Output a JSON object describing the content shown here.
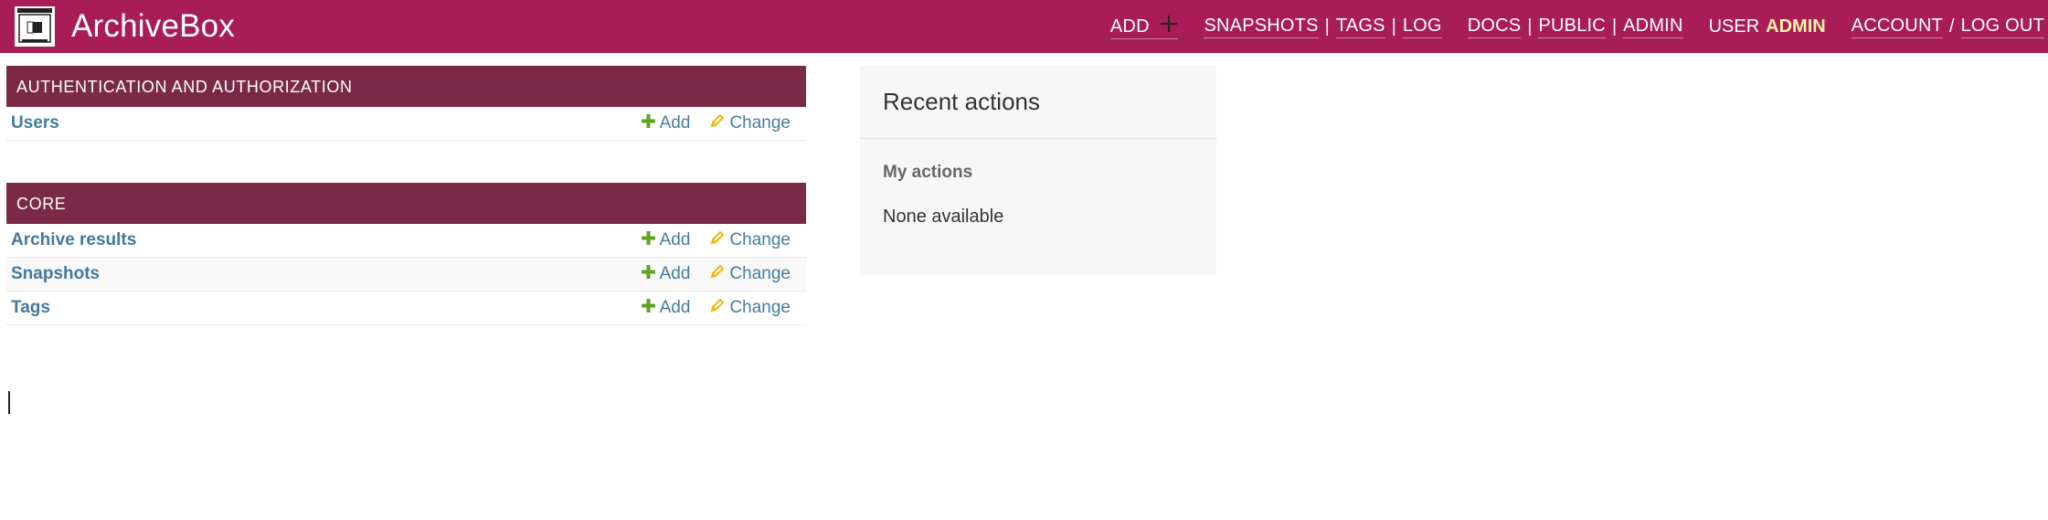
{
  "header": {
    "brand": "ArchiveBox",
    "add_label": "ADD",
    "snapshots_label": "SNAPSHOTS",
    "tags_label": "TAGS",
    "log_label": "LOG",
    "docs_label": "DOCS",
    "public_label": "PUBLIC",
    "admin_label": "ADMIN",
    "user_prefix": "USER",
    "username": "ADMIN",
    "account_label": "ACCOUNT",
    "logout_label": "LOG OUT",
    "sep_bar": "|",
    "sep_slash": "/"
  },
  "modules": [
    {
      "caption": "AUTHENTICATION AND AUTHORIZATION",
      "rows": [
        {
          "name": "Users",
          "add": "Add",
          "change": "Change"
        }
      ]
    },
    {
      "caption": "CORE",
      "rows": [
        {
          "name": "Archive results",
          "add": "Add",
          "change": "Change"
        },
        {
          "name": "Snapshots",
          "add": "Add",
          "change": "Change"
        },
        {
          "name": "Tags",
          "add": "Add",
          "change": "Change"
        }
      ]
    }
  ],
  "recent_actions": {
    "title": "Recent actions",
    "subtitle": "My actions",
    "empty_text": "None available"
  },
  "colors": {
    "header_bg": "#a81d55",
    "module_caption_bg": "#7a2a47",
    "link": "#447e9b",
    "add_icon": "#5fa225",
    "change_icon": "#efb80b",
    "username": "#fff0a8"
  },
  "icons": {
    "logo": "archivebox-logo-icon",
    "add": "plus-icon",
    "change": "pencil-icon"
  }
}
